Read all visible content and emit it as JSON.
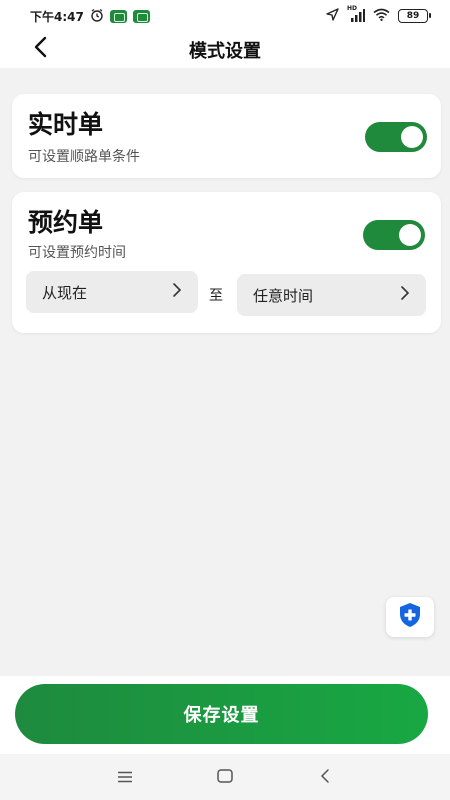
{
  "status": {
    "time": "下午4:47",
    "battery": "89",
    "network_label": "HD"
  },
  "header": {
    "title": "模式设置"
  },
  "realtime": {
    "title": "实时单",
    "subtitle": "可设置顺路单条件",
    "enabled": true
  },
  "reservation": {
    "title": "预约单",
    "subtitle": "可设置预约时间",
    "enabled": true,
    "from_label": "从现在",
    "to_separator": "至",
    "to_label": "任意时间"
  },
  "footer": {
    "save_label": "保存设置"
  },
  "colors": {
    "accent": "#1f8a3b",
    "background": "#f2f2f2",
    "card": "#ffffff",
    "shield": "#1565e0"
  },
  "icons": {
    "back": "chevron-left-icon",
    "alarm": "alarm-clock-icon",
    "location": "location-arrow-icon",
    "signal": "signal-bars-icon",
    "wifi": "wifi-icon",
    "battery": "battery-icon",
    "arrow": "chevron-right-icon",
    "shield": "shield-plus-icon",
    "menu": "menu-icon",
    "home": "home-square-icon",
    "nav_back": "nav-back-icon"
  }
}
